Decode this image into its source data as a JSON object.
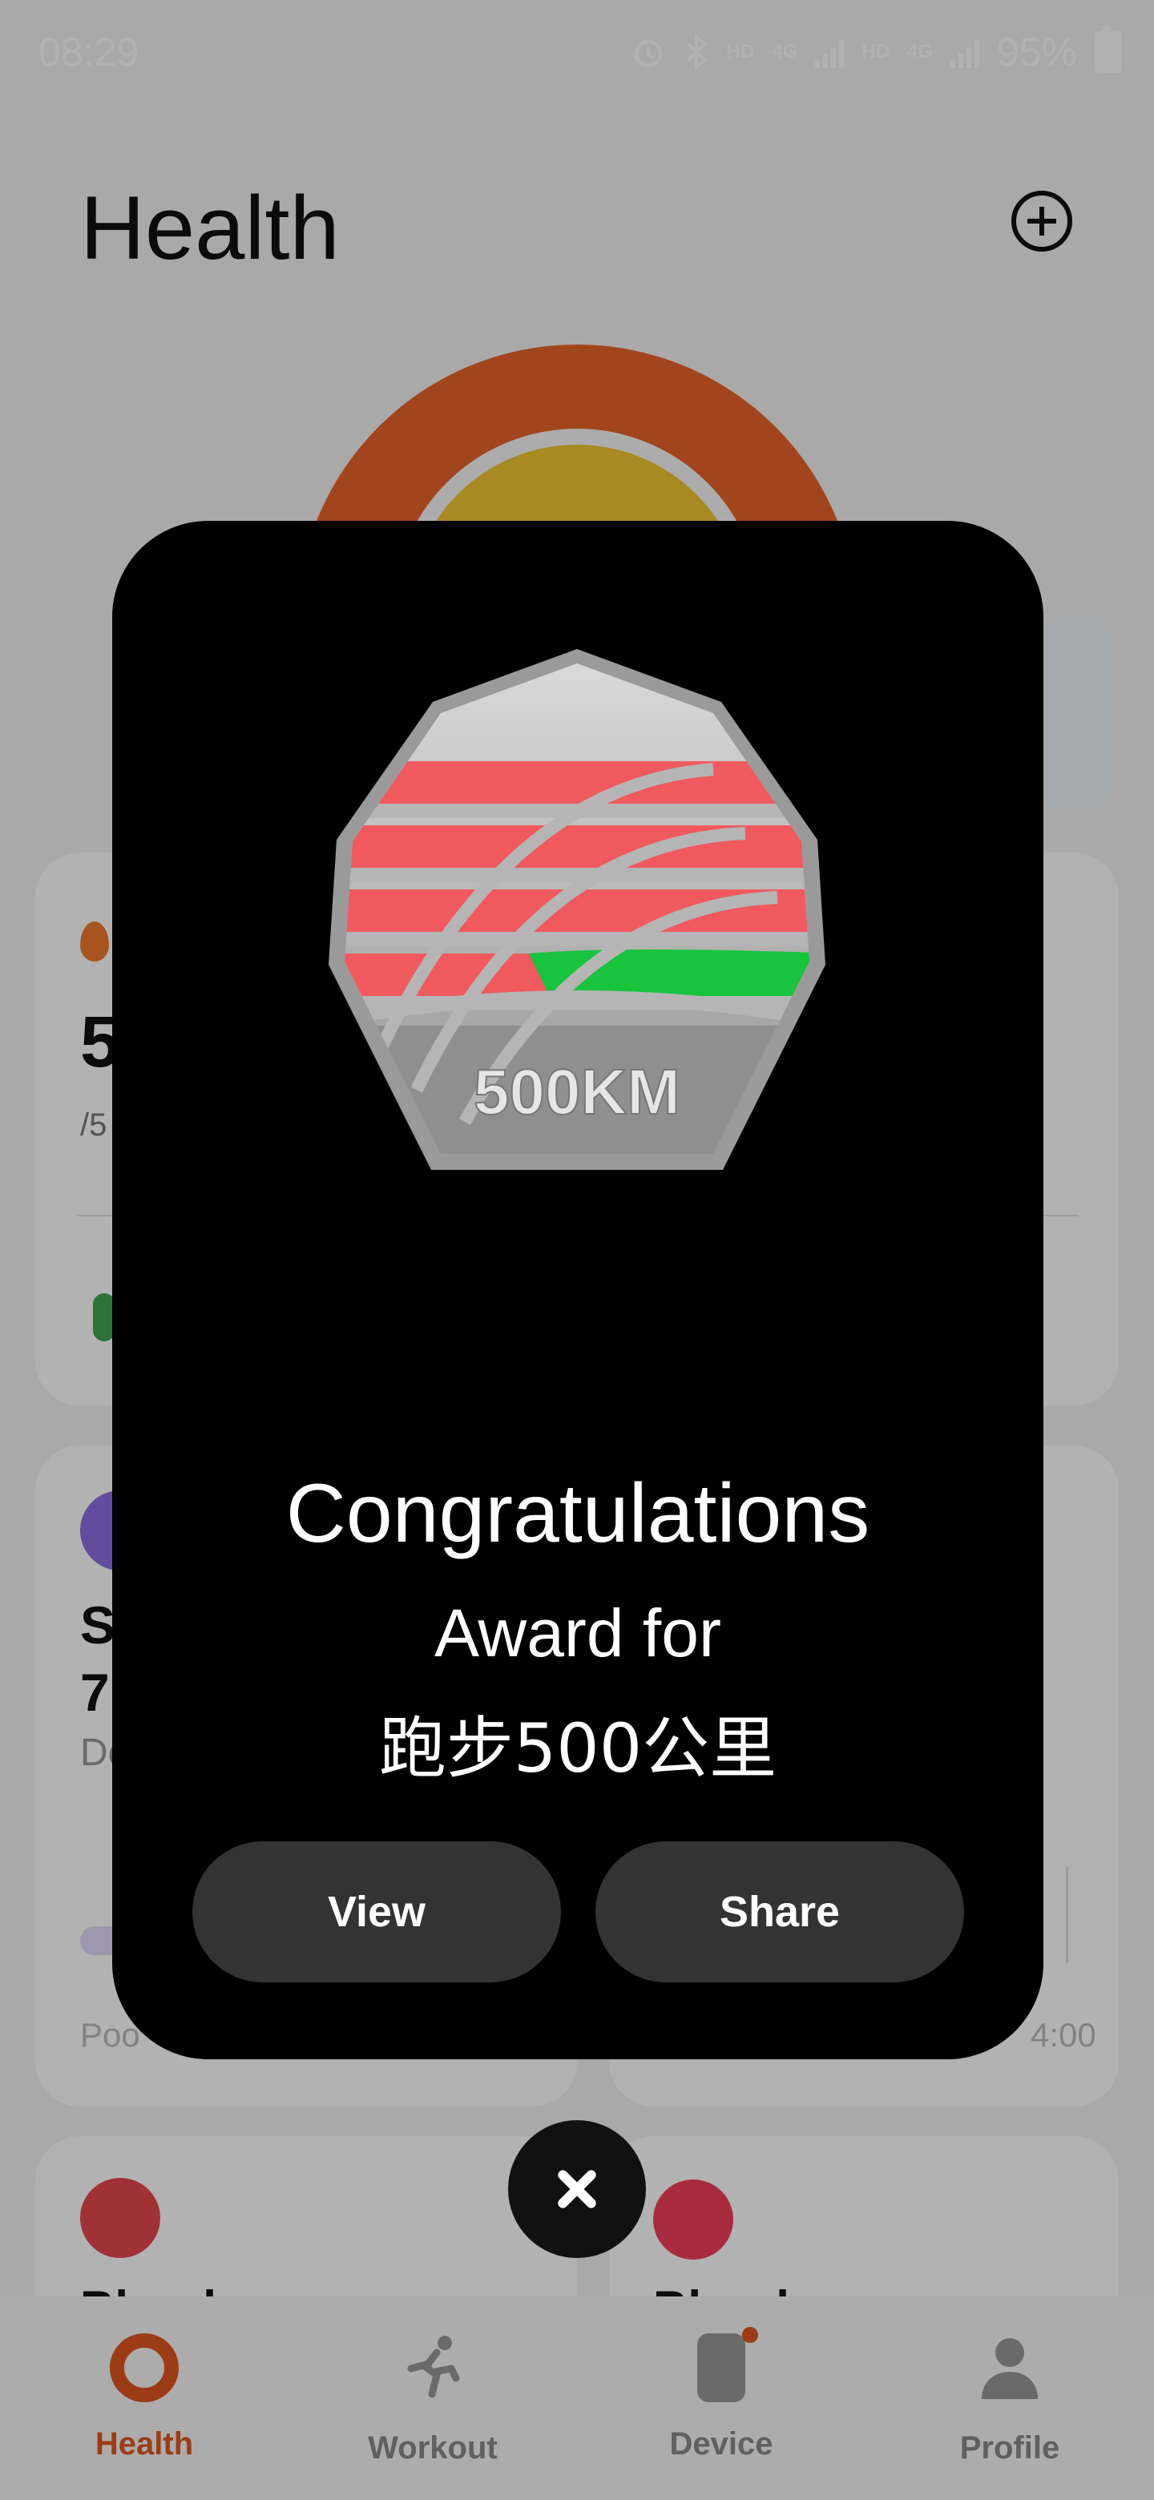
{
  "status_bar": {
    "time": "08:29",
    "hd1": "HD",
    "net1": "4G",
    "hd2": "HD",
    "net2": "4G",
    "battery": "95%",
    "icons": [
      "alarm-icon",
      "bluetooth-icon",
      "signal-icon",
      "battery-icon"
    ]
  },
  "header": {
    "title": "Health",
    "add_icon": "plus-circle-icon"
  },
  "background": {
    "calories_value_partial": "5",
    "calories_sub_partial": "/5",
    "sleep_title_partial": "S",
    "sleep_value_partial": "7",
    "sleep_sub_partial": "De",
    "sleep_quality_partial": "Poo",
    "time_partial": "4:00",
    "blood1_partial": "Blood",
    "blood2_partial": "Blood"
  },
  "modal": {
    "medal_text": "500KM",
    "title": "Congratulations",
    "award_label": "Award for",
    "award_name": "跑步500公里",
    "view_button": "View",
    "share_button": "Share",
    "close_icon": "close-icon",
    "colors": {
      "background": "#000000",
      "button": "#333333",
      "stripe_red": "#f05a5f",
      "stripe_green": "#18c43c",
      "silver": "#a8a8a8"
    }
  },
  "tabs": [
    {
      "label": "Health",
      "icon": "ring-icon",
      "active": true
    },
    {
      "label": "Workout",
      "icon": "running-icon",
      "active": false
    },
    {
      "label": "Device",
      "icon": "watch-icon",
      "active": false,
      "badge": true
    },
    {
      "label": "Profile",
      "icon": "person-icon",
      "active": false
    }
  ],
  "accent_color": "#e0561f"
}
